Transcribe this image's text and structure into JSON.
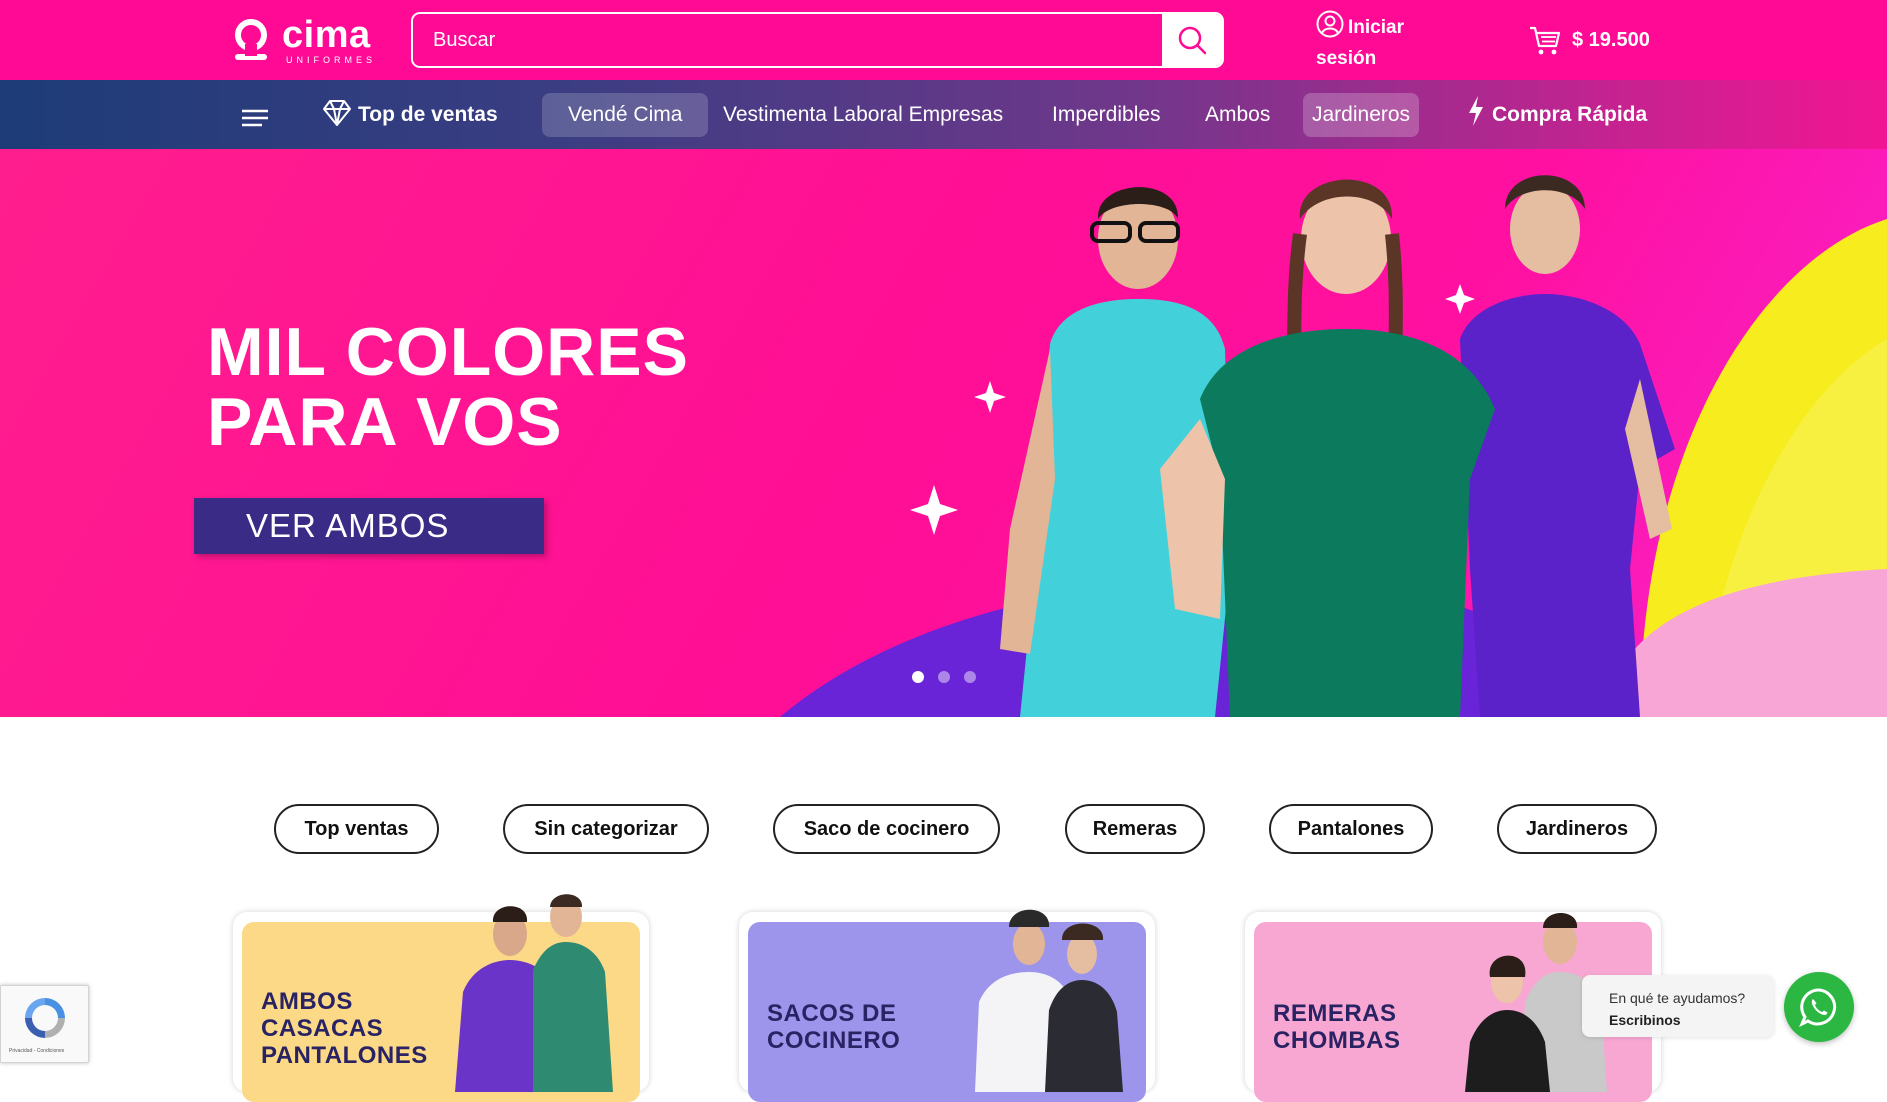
{
  "brand": {
    "name": "cima",
    "subtitle": "UNIFORMES"
  },
  "header": {
    "search_placeholder": "Buscar",
    "login_line1": "Iniciar",
    "login_line2": "sesión",
    "cart_total": "$ 19.500"
  },
  "nav": {
    "top_ventas": "Top de ventas",
    "items": [
      "Vendé Cima",
      "Vestimenta Laboral Empresas",
      "Imperdibles",
      "Ambos",
      "Jardineros"
    ],
    "compra_rapida": "Compra Rápida"
  },
  "hero": {
    "title": "MIL COLORES\nPARA VOS",
    "cta": "VER AMBOS",
    "slides": 3,
    "active_slide": 1
  },
  "categories": [
    "Top ventas",
    "Sin categorizar",
    "Saco de cocinero",
    "Remeras",
    "Pantalones",
    "Jardineros"
  ],
  "cards": [
    {
      "title": "AMBOS\nCASACAS\nPANTALONES"
    },
    {
      "title": "SACOS DE\nCOCINERO"
    },
    {
      "title": "REMERAS\nCHOMBAS"
    }
  ],
  "whatsapp": {
    "line1": "En qué te ayudamos?",
    "line2": "Escribinos"
  },
  "recaptcha": {
    "links": "Privacidad - Condiciones"
  },
  "colors": {
    "primary_pink": "#ff0a94",
    "nav_start": "#1d3c78",
    "cta_purple": "#3a2c86",
    "whatsapp_green": "#2bb741"
  }
}
